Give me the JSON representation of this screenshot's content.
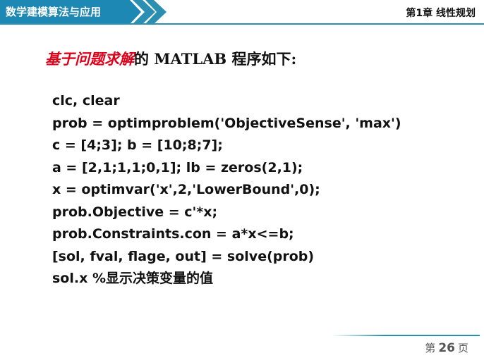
{
  "header": {
    "course_title": "数学建模算法与应用",
    "chapter_title": "第1章 线性规划",
    "colors": {
      "band": "#1e88b4",
      "chevron": "#2a8fb0",
      "rule": "#2a8fb0"
    }
  },
  "heading": {
    "highlight": "基于问题求解",
    "rest": "的 MATLAB 程序如下:",
    "highlight_color": "#e0001a"
  },
  "code_lines": [
    "clc, clear",
    "prob = optimproblem('ObjectiveSense', 'max')",
    "c = [4;3]; b = [10;8;7];",
    "a = [2,1;1,1;0,1]; lb = zeros(2,1);",
    "x = optimvar('x',2,'LowerBound',0);",
    "prob.Objective = c'*x;",
    "prob.Constraints.con = a*x<=b;",
    "[sol, fval, flage, out] = solve(prob)",
    "sol.x  %显示决策变量的值"
  ],
  "footer": {
    "page_prefix": "第",
    "page_number": "26",
    "page_suffix": "页"
  }
}
